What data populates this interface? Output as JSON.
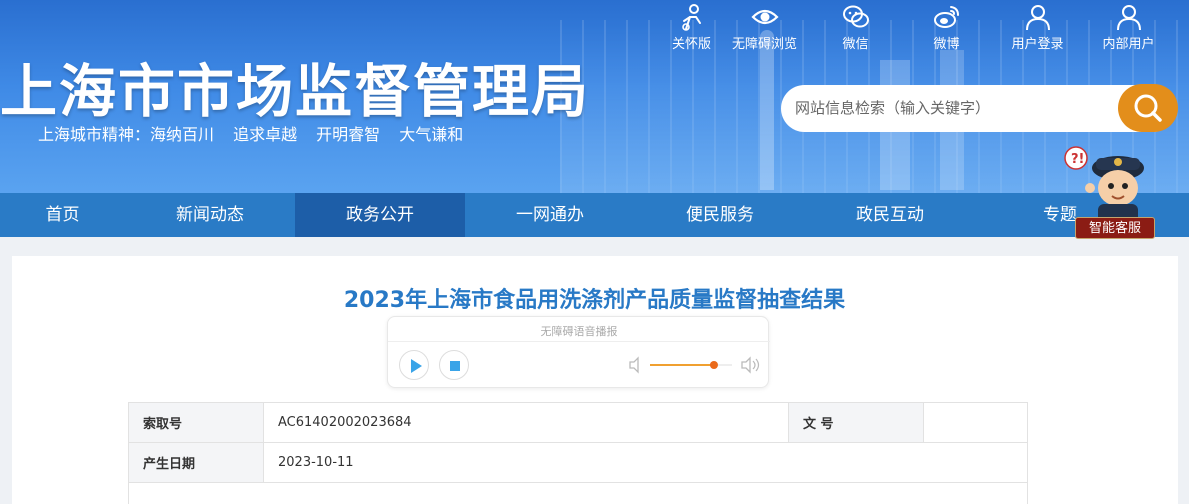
{
  "header": {
    "site_title": "上海市市场监督管理局",
    "motto": "上海城市精神：海纳百川  追求卓越  开明睿智  大气谦和",
    "toolbar": [
      {
        "label": "关怀版",
        "icon": "care-icon"
      },
      {
        "label": "无障碍浏览",
        "icon": "eye-icon"
      },
      {
        "label": "微信",
        "icon": "wechat-icon"
      },
      {
        "label": "微博",
        "icon": "weibo-icon"
      },
      {
        "label": "用户登录",
        "icon": "user-icon"
      },
      {
        "label": "内部用户",
        "icon": "user-icon"
      }
    ],
    "search": {
      "placeholder": "网站信息检索（输入关键字）",
      "button_icon": "search-icon"
    }
  },
  "nav": {
    "items": [
      "首页",
      "新闻动态",
      "政务公开",
      "一网通办",
      "便民服务",
      "政民互动",
      "专题"
    ],
    "active": "政务公开"
  },
  "robot": {
    "label": "智能客服",
    "icon": "robot-assistant-icon"
  },
  "article": {
    "title": "2023年上海市食品用洗涤剂产品质量监督抽查结果",
    "player": {
      "caption": "无障碍语音播报",
      "volume": 0.78
    }
  },
  "meta": {
    "index_label": "索取号",
    "index_value": "AC61402002023684",
    "doc_label": "文  号",
    "doc_value": "",
    "date_label": "产生日期",
    "date_value": "2023-10-11"
  },
  "colors": {
    "primary": "#2a7bc6",
    "nav_active": "#1d5ea8",
    "accent": "#e38e1b",
    "title": "#2879c6"
  }
}
